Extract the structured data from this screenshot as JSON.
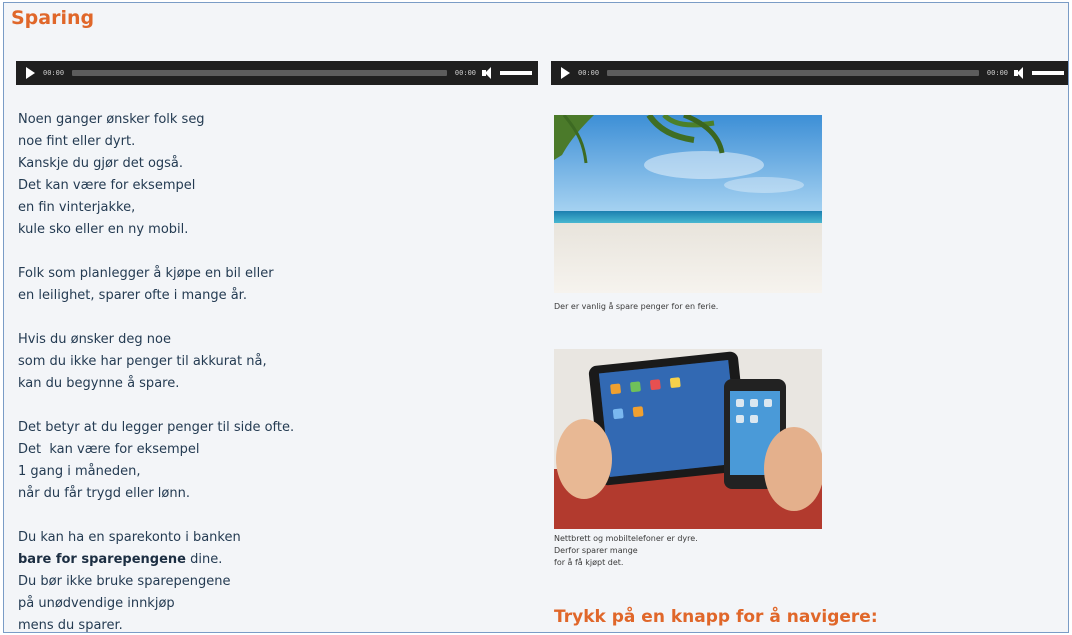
{
  "page": {
    "title": "Sparing",
    "nav_heading": "Trykk på en knapp for å navigere:"
  },
  "players": [
    {
      "current_time": "00:00",
      "duration": "00:00"
    },
    {
      "current_time": "00:00",
      "duration": "00:00"
    }
  ],
  "text": {
    "paragraphs": [
      [
        "Noen ganger ønsker folk seg",
        "noe fint eller dyrt.",
        "Kanskje du gjør det også.",
        "Det kan være for eksempel",
        "en fin vinterjakke,",
        "kule sko eller en ny mobil."
      ],
      [
        "Folk som planlegger å kjøpe en bil eller",
        "en leilighet, sparer ofte i mange år."
      ],
      [
        "Hvis du ønsker deg noe",
        "som du ikke har penger til akkurat nå,",
        "kan du begynne å spare."
      ],
      [
        "Det betyr at du legger penger til side ofte.",
        "Det  kan være for eksempel",
        "1 gang i måneden,",
        "når du får trygd eller lønn."
      ]
    ],
    "last_paragraph": {
      "line1": "Du kan ha en sparekonto i banken",
      "line2_bold": "bare for sparepengene",
      "line2_rest": " dine.",
      "line3": "Du bør ikke bruke sparepengene",
      "line4": "på unødvendige innkjøp",
      "line5": "mens du sparer."
    }
  },
  "images": {
    "beach_caption": "Der er vanlig å spare penger for en ferie.",
    "tablet_caption": [
      "Nettbrett og mobiltelefoner er dyre.",
      "Derfor sparer mange",
      "for å få kjøpt det."
    ]
  },
  "colors": {
    "accent": "#e0672a",
    "body_text": "#243b52",
    "player_bg": "#1f1f1f"
  }
}
